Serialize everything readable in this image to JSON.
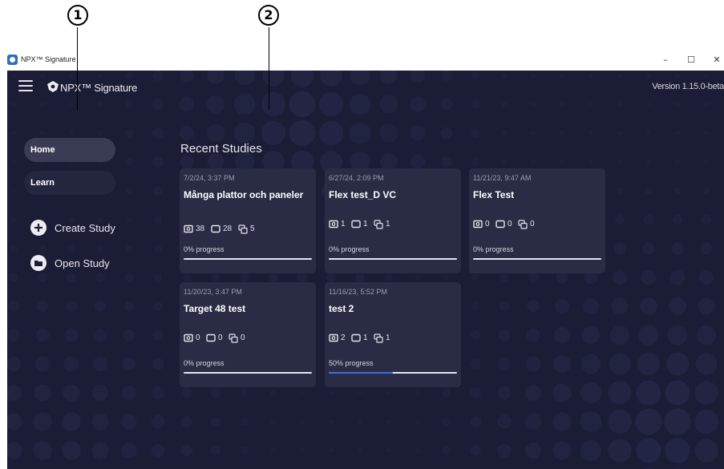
{
  "callouts": [
    "1",
    "2"
  ],
  "window": {
    "title": "NPX™ Signature",
    "minimize": "–",
    "maximize": "☐",
    "close": "✕"
  },
  "header": {
    "brand": "NPX™ Signature",
    "version": "Version 1.15.0-beta"
  },
  "sidebar": {
    "items": [
      {
        "label": "Home",
        "active": true
      },
      {
        "label": "Learn",
        "active": false
      }
    ],
    "actions": [
      {
        "label": "Create Study",
        "icon": "plus-icon"
      },
      {
        "label": "Open Study",
        "icon": "folder-icon"
      }
    ]
  },
  "main": {
    "title": "Recent Studies",
    "studies": [
      {
        "date": "7/2/24, 3:37 PM",
        "title": "Många plattor och paneler",
        "plates": "38",
        "panels": "28",
        "groups": "5",
        "progress_label": "0% progress",
        "progress": 0
      },
      {
        "date": "6/27/24, 2:09 PM",
        "title": "Flex test_D VC",
        "plates": "1",
        "panels": "1",
        "groups": "1",
        "progress_label": "0% progress",
        "progress": 0
      },
      {
        "date": "11/21/23, 9:47 AM",
        "title": "Flex Test",
        "plates": "0",
        "panels": "0",
        "groups": "0",
        "progress_label": "0% progress",
        "progress": 0
      },
      {
        "date": "11/20/23, 3:47 PM",
        "title": "Target 48 test",
        "plates": "0",
        "panels": "0",
        "groups": "0",
        "progress_label": "0% progress",
        "progress": 0
      },
      {
        "date": "11/16/23, 5:52 PM",
        "title": "test 2",
        "plates": "2",
        "panels": "1",
        "groups": "1",
        "progress_label": "50% progress",
        "progress": 50
      }
    ]
  },
  "colors": {
    "background": "#1b1c35",
    "card": "#2a2b45",
    "progress_fill": "#3d6fe0"
  }
}
